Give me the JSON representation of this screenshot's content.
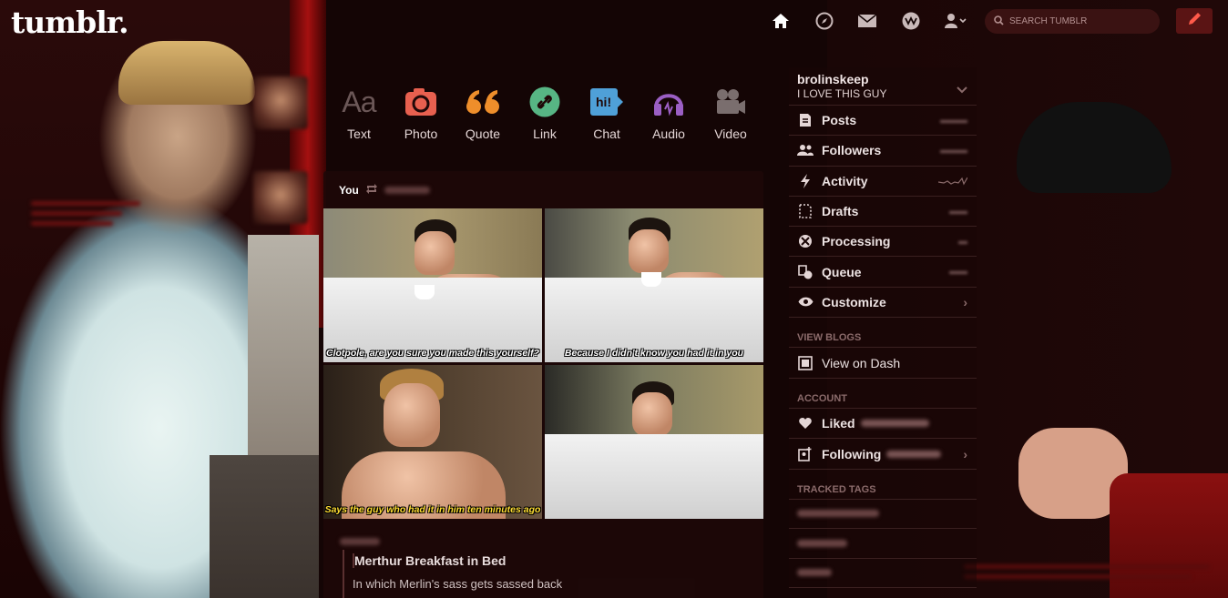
{
  "header": {
    "logo": "tumblr.",
    "search_placeholder": "Search Tumblr",
    "icons": [
      "home-icon",
      "explore-icon",
      "inbox-icon",
      "activity-icon",
      "account-icon"
    ]
  },
  "post_types": [
    {
      "label": "Text",
      "icon": "text-icon",
      "color": "#6b5757"
    },
    {
      "label": "Photo",
      "icon": "camera-icon",
      "color": "#e8604f"
    },
    {
      "label": "Quote",
      "icon": "quote-icon",
      "color": "#ee8e2b"
    },
    {
      "label": "Link",
      "icon": "link-icon",
      "color": "#57b584"
    },
    {
      "label": "Chat",
      "icon": "chat-icon",
      "color": "#4fa0d8"
    },
    {
      "label": "Audio",
      "icon": "headphones-icon",
      "color": "#9b5fc4"
    },
    {
      "label": "Video",
      "icon": "video-camera-icon",
      "color": "#7a6e6e"
    }
  ],
  "post": {
    "author": "You",
    "captions": [
      "Clotpole, are you sure you made this yourself?",
      "Because I didn't know you had it in you",
      "Says the guy who had it in him ten minutes ago",
      ""
    ],
    "title": "Merthur Breakfast in Bed",
    "subtitle": "In which Merlin's sass gets sassed back"
  },
  "sidebar": {
    "blog_name": "brolinskeep",
    "blog_desc": "I LOVE THIS GUY",
    "items": [
      {
        "label": "Posts",
        "icon": "posts-icon"
      },
      {
        "label": "Followers",
        "icon": "followers-icon"
      },
      {
        "label": "Activity",
        "icon": "lightning-icon"
      },
      {
        "label": "Drafts",
        "icon": "drafts-icon"
      },
      {
        "label": "Processing",
        "icon": "processing-icon"
      },
      {
        "label": "Queue",
        "icon": "queue-icon"
      },
      {
        "label": "Customize",
        "icon": "eye-icon"
      }
    ],
    "view_blogs_heading": "View Blogs",
    "view_on_dash": "View on Dash",
    "account_heading": "Account",
    "liked": "Liked",
    "following": "Following",
    "tracked_tags_heading": "Tracked Tags"
  }
}
